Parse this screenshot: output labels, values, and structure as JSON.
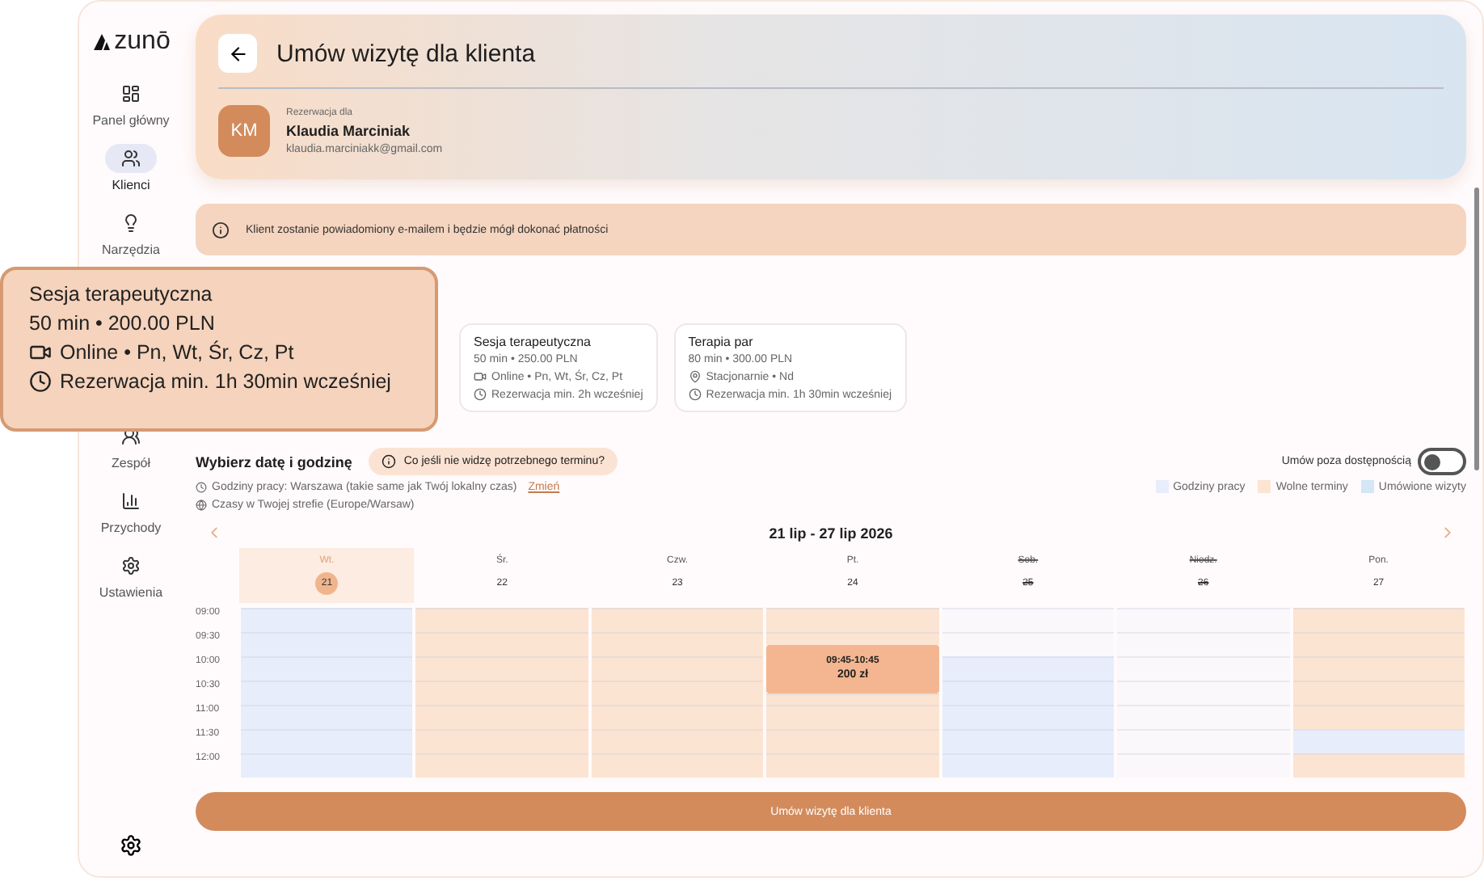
{
  "brand": {
    "name": "zunō"
  },
  "sidebar": {
    "items": [
      {
        "label": "Panel główny",
        "selected": false
      },
      {
        "label": "Klienci",
        "selected": true
      },
      {
        "label": "Narzędzia",
        "selected": false
      },
      {
        "label": "Zespół",
        "selected": false
      },
      {
        "label": "Przychody",
        "selected": false
      },
      {
        "label": "Ustawienia",
        "selected": false
      }
    ]
  },
  "header": {
    "title": "Umów wizytę dla klienta",
    "booking_for_label": "Rezerwacja dla",
    "client": {
      "initials": "KM",
      "name": "Klaudia Marciniak",
      "email": "klaudia.marciniakk@gmail.com"
    }
  },
  "info_banner": "Klient zostanie powiadomiony e-mailem i będzie mógł dokonać płatności",
  "services": [
    {
      "name": "Sesja terapeutyczna",
      "price": "50 min • 250.00 PLN",
      "kind": "online",
      "availability": "Online • Pn, Wt, Śr, Cz, Pt",
      "notice": "Rezerwacja min. 2h wcześniej"
    },
    {
      "name": "Terapia par",
      "price": "80 min • 300.00 PLN",
      "kind": "onsite",
      "availability": "Stacjonarnie • Nd",
      "notice": "Rezerwacja min. 1h 30min wcześniej"
    }
  ],
  "tooltip": {
    "name": "Sesja terapeutyczna",
    "price": "50 min • 200.00 PLN",
    "kind": "online",
    "availability": "Online • Pn, Wt, Śr, Cz, Pt",
    "notice": "Rezerwacja min. 1h 30min wcześniej"
  },
  "schedule": {
    "title": "Wybierz datę i godzinę",
    "help_chip": "Co jeśli nie widzę potrzebnego terminu?",
    "outside_toggle": {
      "label": "Umów poza dostępnością",
      "on": false
    },
    "working_hours": "Godziny pracy: Warszawa (takie same jak Twój lokalny czas)",
    "change_link": "Zmień",
    "timezone": "Czasy w Twojej strefie (Europe/Warsaw)",
    "legend": [
      {
        "label": "Godziny pracy",
        "color": "#e8edfb"
      },
      {
        "label": "Wolne terminy",
        "color": "#fce4d2"
      },
      {
        "label": "Umówione wizyty",
        "color": "#d5e6f6"
      }
    ],
    "range": "21 lip - 27 lip 2026",
    "times": [
      "09:00",
      "09:30",
      "10:00",
      "10:30",
      "11:00",
      "11:30",
      "12:00"
    ],
    "days": [
      {
        "name": "Wt.",
        "date": "21",
        "selected": true,
        "disabled": false,
        "slots": [
          {
            "kind": "work"
          },
          {
            "kind": "work"
          },
          {
            "kind": "work"
          },
          {
            "kind": "work"
          },
          {
            "kind": "work"
          },
          {
            "kind": "work"
          },
          {
            "kind": "work"
          }
        ]
      },
      {
        "name": "Śr.",
        "date": "22",
        "selected": false,
        "disabled": false,
        "slots": [
          {
            "kind": "free"
          },
          {
            "kind": "free"
          },
          {
            "kind": "free"
          },
          {
            "kind": "free"
          },
          {
            "kind": "free"
          },
          {
            "kind": "free"
          },
          {
            "kind": "free"
          }
        ]
      },
      {
        "name": "Czw.",
        "date": "23",
        "selected": false,
        "disabled": false,
        "slots": [
          {
            "kind": "free"
          },
          {
            "kind": "free"
          },
          {
            "kind": "free"
          },
          {
            "kind": "free"
          },
          {
            "kind": "free"
          },
          {
            "kind": "free"
          },
          {
            "kind": "free"
          }
        ]
      },
      {
        "name": "Pt.",
        "date": "24",
        "selected": false,
        "disabled": false,
        "slots": [
          {
            "kind": "free"
          },
          {
            "kind": "free"
          },
          {
            "kind": "appointment",
            "time": "09:45-10:45",
            "price": "200 zł"
          },
          {
            "kind": "free"
          },
          {
            "kind": "free"
          },
          {
            "kind": "free"
          },
          {
            "kind": "free"
          }
        ]
      },
      {
        "name": "Sob.",
        "date": "25",
        "selected": false,
        "disabled": true,
        "slots": [
          {
            "kind": "empty"
          },
          {
            "kind": "empty"
          },
          {
            "kind": "work"
          },
          {
            "kind": "work"
          },
          {
            "kind": "work"
          },
          {
            "kind": "work"
          },
          {
            "kind": "work"
          }
        ]
      },
      {
        "name": "Niedz.",
        "date": "26",
        "selected": false,
        "disabled": true,
        "slots": [
          {
            "kind": "empty"
          },
          {
            "kind": "empty"
          },
          {
            "kind": "empty"
          },
          {
            "kind": "empty"
          },
          {
            "kind": "empty"
          },
          {
            "kind": "empty"
          },
          {
            "kind": "empty"
          }
        ]
      },
      {
        "name": "Pon.",
        "date": "27",
        "selected": false,
        "disabled": false,
        "slots": [
          {
            "kind": "free"
          },
          {
            "kind": "free"
          },
          {
            "kind": "free"
          },
          {
            "kind": "free"
          },
          {
            "kind": "free"
          },
          {
            "kind": "work"
          },
          {
            "kind": "free"
          }
        ]
      }
    ]
  },
  "submit_button": "Umów wizytę dla klienta"
}
